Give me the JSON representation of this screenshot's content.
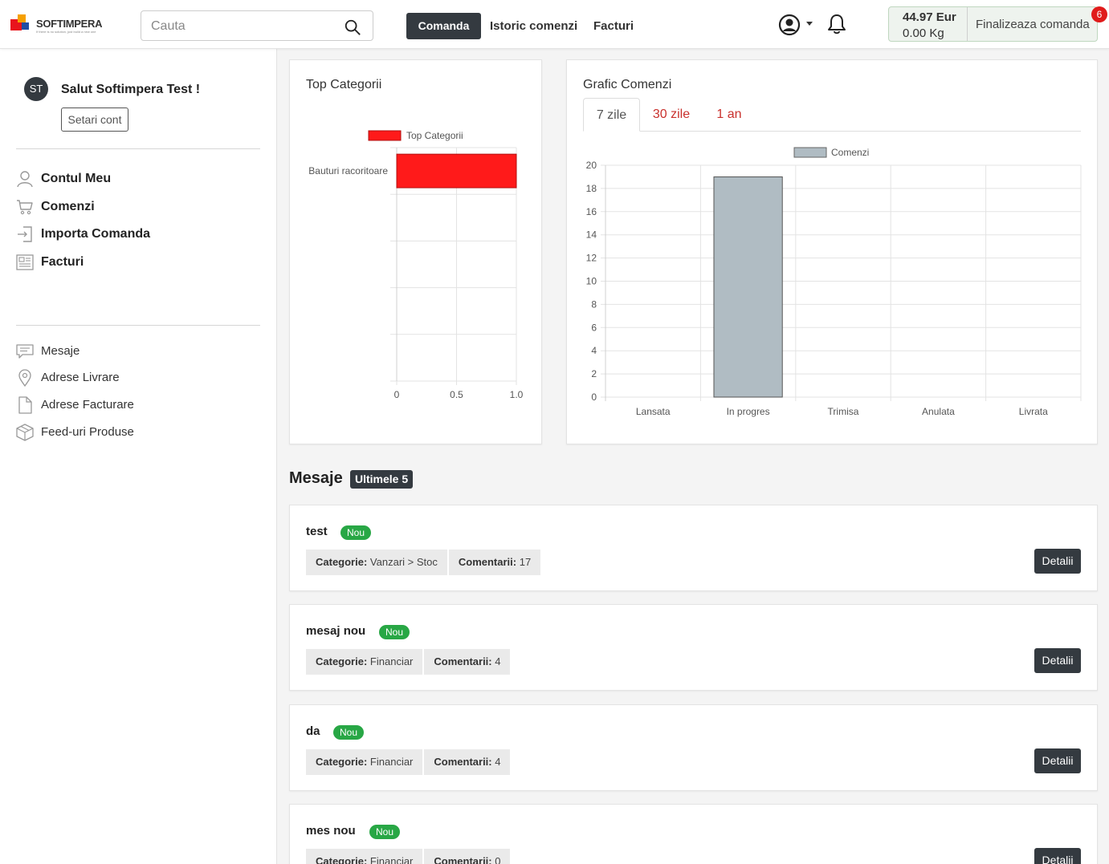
{
  "brand": {
    "name": "SOFTIMPERA",
    "tagline": "If there is no solution, just build a new one",
    "colors": {
      "red": "#e8141c",
      "blue": "#1f4ea3",
      "orange": "#f6a000"
    }
  },
  "header": {
    "search_placeholder": "Cauta",
    "nav": {
      "order": "Comanda",
      "history": "Istoric comenzi",
      "invoices": "Facturi"
    },
    "cart": {
      "amount": "44.97 Eur",
      "weight": "0.00 Kg",
      "finish_label": "Finalizeaza comanda",
      "badge": "6"
    }
  },
  "sidebar": {
    "avatar_initials": "ST",
    "greeting": "Salut Softimpera Test !",
    "settings_label": "Setari cont",
    "main_menu": [
      {
        "label": "Contul Meu",
        "icon": "user-icon"
      },
      {
        "label": "Comenzi",
        "icon": "cart-icon"
      },
      {
        "label": "Importa Comanda",
        "icon": "import-icon"
      },
      {
        "label": "Facturi",
        "icon": "invoice-icon"
      }
    ],
    "sub_menu": [
      {
        "label": "Mesaje",
        "icon": "message-icon"
      },
      {
        "label": "Adrese Livrare",
        "icon": "location-pin-icon"
      },
      {
        "label": "Adrese Facturare",
        "icon": "file-icon"
      },
      {
        "label": "Feed-uri Produse",
        "icon": "box-icon"
      }
    ]
  },
  "top_categories": {
    "title": "Top Categorii",
    "chart_data": {
      "type": "bar",
      "orientation": "horizontal",
      "categories": [
        "Bauturi racoritoare"
      ],
      "series": [
        {
          "name": "Top Categorii",
          "values": [
            1
          ],
          "color": "#ff1a1a"
        }
      ],
      "xticks": [
        "0",
        "0.5",
        "1.0"
      ],
      "xlim": [
        0,
        1
      ],
      "legend": "top",
      "grid": true
    }
  },
  "orders_chart": {
    "title": "Grafic Comenzi",
    "tabs": [
      "7 zile",
      "30 zile",
      "1 an"
    ],
    "active_tab": "7 zile",
    "chart_data": {
      "type": "bar",
      "categories": [
        "Lansata",
        "In progres",
        "Trimisa",
        "Anulata",
        "Livrata"
      ],
      "series": [
        {
          "name": "Comenzi",
          "values": [
            0,
            19,
            0,
            0,
            0
          ],
          "color": "#b0bcc3"
        }
      ],
      "yticks": [
        "0",
        "2",
        "4",
        "6",
        "8",
        "10",
        "12",
        "14",
        "16",
        "18",
        "20"
      ],
      "ylim": [
        0,
        20
      ],
      "legend": "top",
      "grid": true
    }
  },
  "messages": {
    "title": "Mesaje",
    "badge": "Ultimele 5",
    "category_label": "Categorie:",
    "comments_label": "Comentarii:",
    "details_label": "Detalii",
    "new_label": "Nou",
    "items": [
      {
        "title": "test",
        "category": "Vanzari > Stoc",
        "comments": "17"
      },
      {
        "title": "mesaj nou",
        "category": "Financiar",
        "comments": "4"
      },
      {
        "title": "da",
        "category": "Financiar",
        "comments": "4"
      },
      {
        "title": "mes nou",
        "category": "Financiar",
        "comments": "0"
      }
    ]
  }
}
